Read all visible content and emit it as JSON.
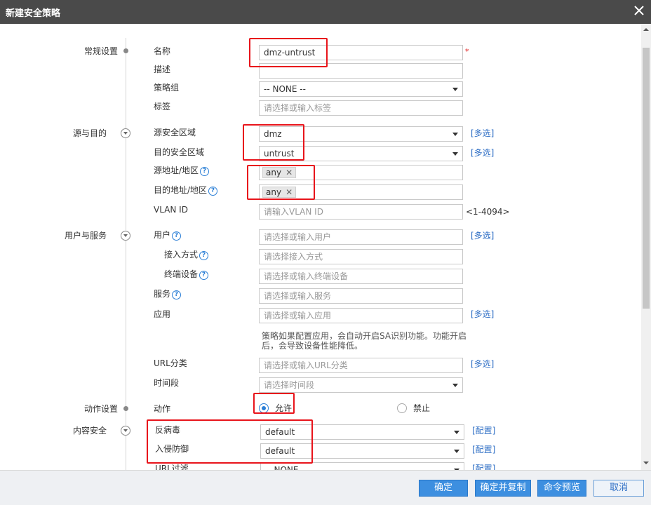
{
  "dialog": {
    "title": "新建安全策略"
  },
  "sections": {
    "general": "常规设置",
    "src_dst": "源与目的",
    "user_service": "用户与服务",
    "action": "动作设置",
    "content_security": "内容安全"
  },
  "general": {
    "name_label": "名称",
    "name_value": "dmz-untrust",
    "required_mark": "*",
    "desc_label": "描述",
    "desc_value": "",
    "group_label": "策略组",
    "group_value": "-- NONE --",
    "tag_label": "标签",
    "tag_placeholder": "请选择或输入标签"
  },
  "src_dst": {
    "src_zone_label": "源安全区域",
    "src_zone_value": "dmz",
    "dst_zone_label": "目的安全区域",
    "dst_zone_value": "untrust",
    "src_addr_label": "源地址/地区",
    "src_addr_tag": "any",
    "dst_addr_label": "目的地址/地区",
    "dst_addr_tag": "any",
    "vlan_label": "VLAN ID",
    "vlan_placeholder": "请输入VLAN ID",
    "vlan_range": "<1-4094>",
    "multi_select": "[多选]"
  },
  "user_service": {
    "user_label": "用户",
    "user_placeholder": "请选择或输入用户",
    "access_label": "接入方式",
    "access_placeholder": "请选择接入方式",
    "device_label": "终端设备",
    "device_placeholder": "请选择或输入终端设备",
    "service_label": "服务",
    "service_placeholder": "请选择或输入服务",
    "app_label": "应用",
    "app_placeholder": "请选择或输入应用",
    "app_note": "策略如果配置应用，会自动开启SA识别功能。功能开启后，会导致设备性能降低。",
    "url_label": "URL分类",
    "url_placeholder": "请选择或输入URL分类",
    "time_label": "时间段",
    "time_placeholder": "请选择时间段"
  },
  "action": {
    "label": "动作",
    "allow": "允许",
    "deny": "禁止",
    "selected": "允许"
  },
  "content_security": {
    "av_label": "反病毒",
    "av_value": "default",
    "ips_label": "入侵防御",
    "ips_value": "default",
    "url_filter_label": "URL过滤",
    "url_filter_value": "-- NONE --",
    "config_link": "[配置]"
  },
  "help_glyph": "?",
  "icons": {
    "close": "close-icon",
    "help": "help-icon"
  },
  "footer": {
    "ok": "确定",
    "ok_copy": "确定并复制",
    "cmd_preview": "命令预览",
    "cancel": "取消"
  },
  "colors": {
    "accent": "#3d8fe0",
    "highlight": "#e8141b",
    "link": "#2b6cc4"
  }
}
